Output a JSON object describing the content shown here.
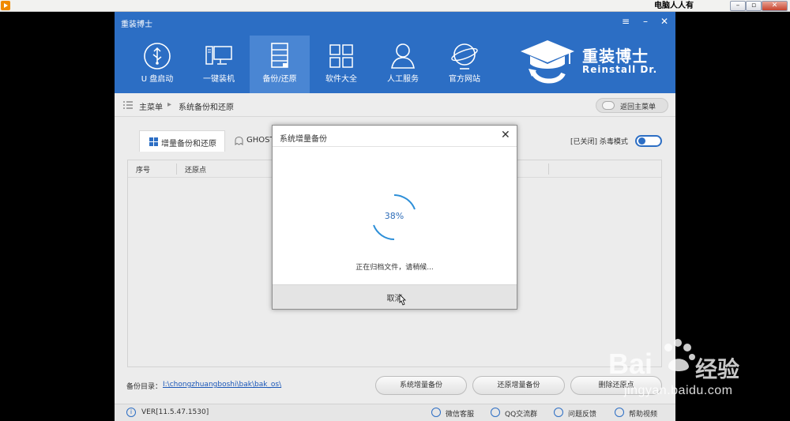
{
  "host_window": {
    "title": "电脑人人有",
    "controls": [
      "–",
      "▫",
      "✕"
    ]
  },
  "app": {
    "title": "重装博士",
    "window_controls": [
      "≡",
      "–",
      "✕"
    ],
    "nav": [
      {
        "label": "U 盘启动",
        "icon": "usb-icon",
        "active": false
      },
      {
        "label": "一键装机",
        "icon": "computer-icon",
        "active": false
      },
      {
        "label": "备份/还原",
        "icon": "server-icon",
        "active": true
      },
      {
        "label": "软件大全",
        "icon": "grid-icon",
        "active": false
      },
      {
        "label": "人工服务",
        "icon": "person-icon",
        "active": false
      },
      {
        "label": "官方网站",
        "icon": "globe-icon",
        "active": false
      }
    ],
    "brand": {
      "cn": "重装博士",
      "en": "Reinstall Dr."
    },
    "accent": "#2c6ec4"
  },
  "breadcrumb": {
    "root": "主菜单",
    "separator": "▸",
    "current": "系统备份和还原",
    "back_label": "返回主菜单"
  },
  "tabs": [
    {
      "label": "增量备份和还原",
      "active": true
    },
    {
      "label": "GHOST",
      "active": false
    }
  ],
  "antivirus": {
    "state": "[已关闭]",
    "label": "杀毒模式"
  },
  "table": {
    "columns": [
      "序号",
      "还原点"
    ]
  },
  "backup_dir": {
    "label": "备份目录：",
    "path": "I:\\chongzhuangboshi\\bak\\bak_os\\"
  },
  "actions": [
    "系统增量备份",
    "还原增量备份",
    "删除还原点"
  ],
  "status_bar": {
    "version": "VER[11.5.47.1530]",
    "links": [
      "微信客服",
      "QQ交流群",
      "问题反馈",
      "帮助视频"
    ]
  },
  "dialog": {
    "title": "系统增量备份",
    "progress_percent": 38,
    "progress_text": "38%",
    "message": "正在归档文件，请稍候...",
    "cancel_label": "取消"
  },
  "watermark": {
    "brand": "Bai",
    "brand2": "经验",
    "url": "jingyan.baidu.com"
  }
}
